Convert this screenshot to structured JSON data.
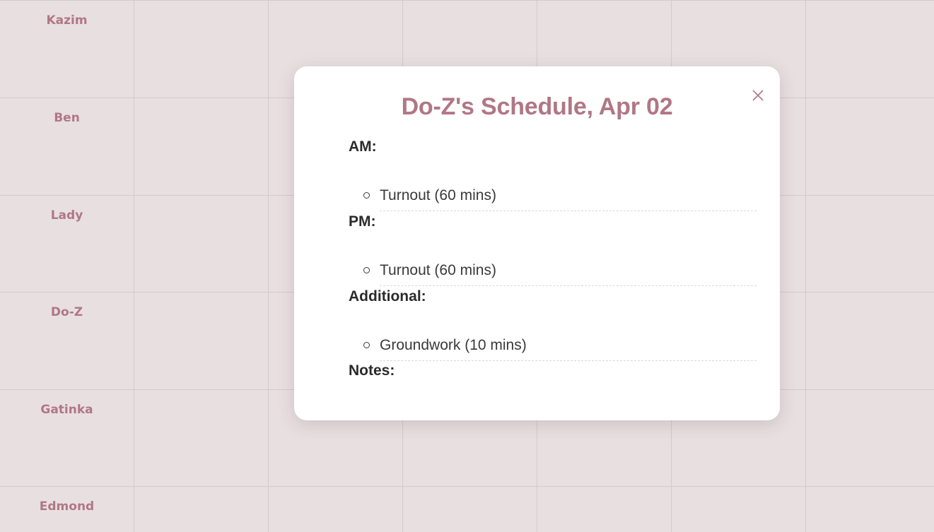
{
  "horses": [
    "Kazim",
    "Ben",
    "Lady",
    "Do-Z",
    "Gatinka",
    "Edmond"
  ],
  "modal": {
    "title": "Do-Z's Schedule, Apr 02",
    "close_icon": "close-icon",
    "sections": {
      "am": {
        "label": "AM:",
        "items": [
          "Turnout (60 mins)"
        ]
      },
      "pm": {
        "label": "PM:",
        "items": [
          "Turnout (60 mins)"
        ]
      },
      "additional": {
        "label": "Additional:",
        "items": [
          "Groundwork (10 mins)"
        ]
      },
      "notes": {
        "label": "Notes:"
      }
    }
  },
  "colors": {
    "accent": "#b07785",
    "background": "#e8dfe1",
    "grid_line": "#d6c8cb",
    "text": "#2b2b2b"
  }
}
